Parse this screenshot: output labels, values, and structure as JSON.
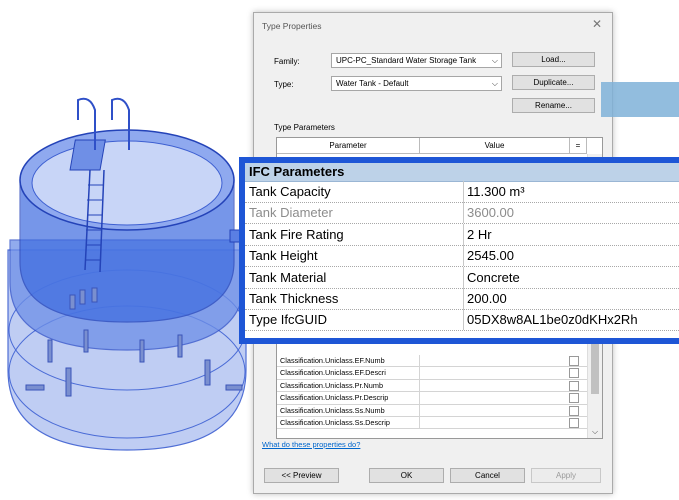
{
  "dialog": {
    "title": "Type Properties",
    "close_icon": "close-icon",
    "family_label": "Family:",
    "family_value": "UPC-PC_Standard Water Storage Tank",
    "type_label": "Type:",
    "type_value": "Water Tank - Default",
    "load_button": "Load...",
    "duplicate_button": "Duplicate...",
    "rename_button": "Rename...",
    "type_parameters_label": "Type Parameters",
    "col_parameter": "Parameter",
    "col_value": "Value",
    "col_eq": "=",
    "rows": [
      "Classification.Uniclass.EF.Numb",
      "Classification.Uniclass.EF.Descri",
      "Classification.Uniclass.Pr.Numb",
      "Classification.Uniclass.Pr.Descrip",
      "Classification.Uniclass.Ss.Numb",
      "Classification.Uniclass.Ss.Descrip"
    ],
    "help_link": "What do these properties do?",
    "preview_button": "<< Preview",
    "ok_button": "OK",
    "cancel_button": "Cancel",
    "apply_button": "Apply"
  },
  "ifc_panel": {
    "header": "IFC Parameters",
    "rows": [
      {
        "name": "Tank Capacity",
        "value": "11.300 m³",
        "muted": false
      },
      {
        "name": "Tank Diameter",
        "value": "3600.00",
        "muted": true
      },
      {
        "name": "Tank Fire Rating",
        "value": "2 Hr",
        "muted": false
      },
      {
        "name": "Tank Height",
        "value": "2545.00",
        "muted": false
      },
      {
        "name": "Tank Material",
        "value": "Concrete",
        "muted": false
      },
      {
        "name": "Tank Thickness",
        "value": "200.00",
        "muted": false
      },
      {
        "name": "Type IfcGUID",
        "value": "05DX8w8AL1be0z0dKHx2Rh",
        "muted": false
      }
    ]
  },
  "colors": {
    "accent_border": "#1e56d6",
    "header_bg": "#bdd2e8",
    "tank_blue": "#3d6be0"
  }
}
